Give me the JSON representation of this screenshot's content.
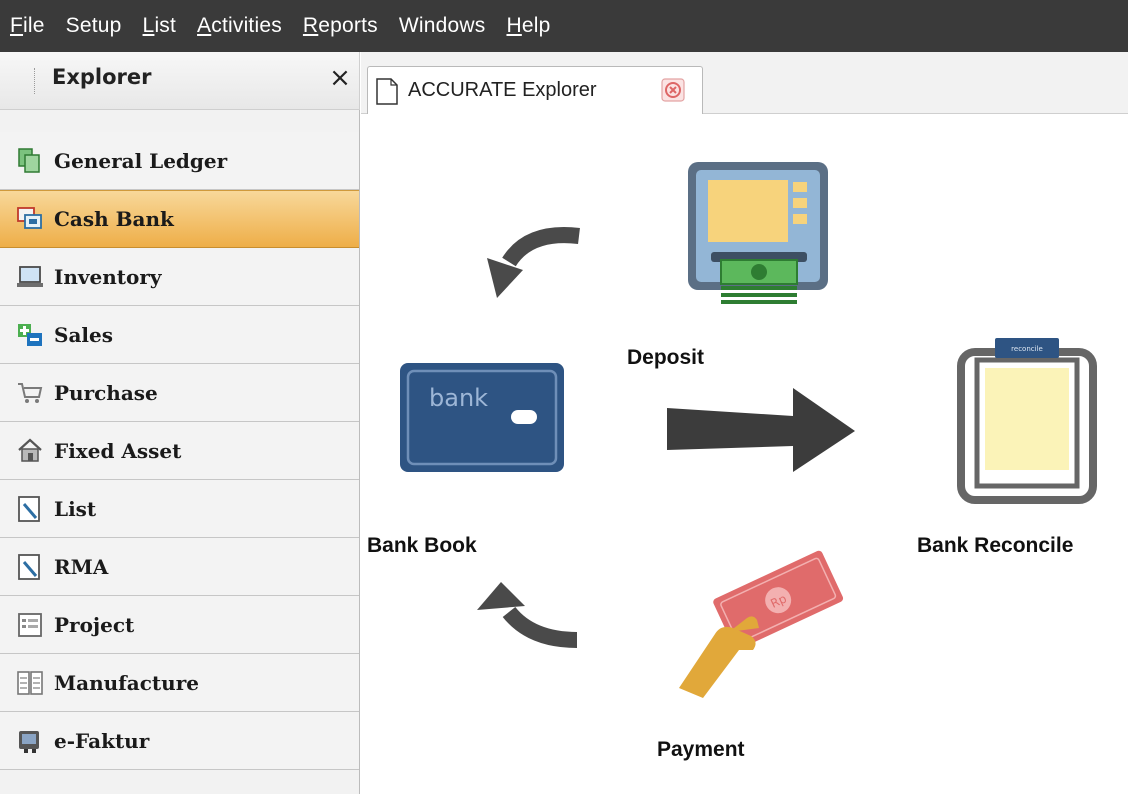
{
  "menubar": {
    "items": [
      {
        "label": "File",
        "u": "F",
        "rest": "ile"
      },
      {
        "label": "Setup",
        "u": "",
        "rest": "Setup"
      },
      {
        "label": "List",
        "u": "L",
        "rest": "ist"
      },
      {
        "label": "Activities",
        "u": "A",
        "rest": "ctivities"
      },
      {
        "label": "Reports",
        "u": "R",
        "rest": "eports"
      },
      {
        "label": "Windows",
        "u": "",
        "rest": "Windows"
      },
      {
        "label": "Help",
        "u": "H",
        "rest": "elp"
      }
    ]
  },
  "explorer": {
    "title": "Explorer",
    "close": "×"
  },
  "sidebar": {
    "items": [
      {
        "label": "General Ledger",
        "icon": "ledger-icon",
        "active": false
      },
      {
        "label": "Cash Bank",
        "icon": "cash-bank-icon",
        "active": true
      },
      {
        "label": "Inventory",
        "icon": "inventory-icon",
        "active": false
      },
      {
        "label": "Sales",
        "icon": "sales-icon",
        "active": false
      },
      {
        "label": "Purchase",
        "icon": "cart-icon",
        "active": false
      },
      {
        "label": "Fixed Asset",
        "icon": "house-icon",
        "active": false
      },
      {
        "label": "List",
        "icon": "list-icon",
        "active": false
      },
      {
        "label": "RMA",
        "icon": "rma-icon",
        "active": false
      },
      {
        "label": "Project",
        "icon": "project-icon",
        "active": false
      },
      {
        "label": "Manufacture",
        "icon": "manufacture-icon",
        "active": false
      },
      {
        "label": "e-Faktur",
        "icon": "efaktur-icon",
        "active": false
      }
    ]
  },
  "tab": {
    "label": "ACCURATE Explorer"
  },
  "diagram": {
    "deposit_label": "Deposit",
    "bank_book_label": "Bank Book",
    "bank_reconcile_label": "Bank Reconcile",
    "payment_label": "Payment",
    "bank_card_text": "bank",
    "clipboard_tag": "reconcile",
    "note_text": "Rp"
  },
  "colors": {
    "menubar": "#3a3a3a",
    "active_item": "#eeae48",
    "bank_blue": "#2e5483",
    "arrow": "#3c3c3c",
    "payment_red": "#e06b6b",
    "hand": "#e1a83a"
  }
}
